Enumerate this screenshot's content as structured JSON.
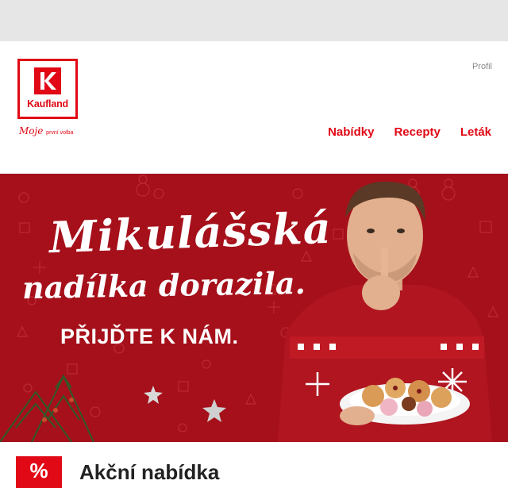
{
  "header": {
    "logo_text": "Kaufland",
    "slogan_main": "Moje",
    "slogan_small": "první volba",
    "profile_link": "Profil",
    "nav": [
      {
        "label": "Nabídky"
      },
      {
        "label": "Recepty"
      },
      {
        "label": "Leták"
      }
    ]
  },
  "hero": {
    "headline_line1": "Mikulášská",
    "headline_line2": "nadílka dorazila.",
    "cta_text": "PŘIJĎTE K NÁM."
  },
  "section": {
    "badge": "%",
    "title": "Akční nabídka"
  },
  "colors": {
    "brand_red": "#e10915",
    "hero_red": "#a5101a",
    "topbar_gray": "#e6e6e6"
  }
}
